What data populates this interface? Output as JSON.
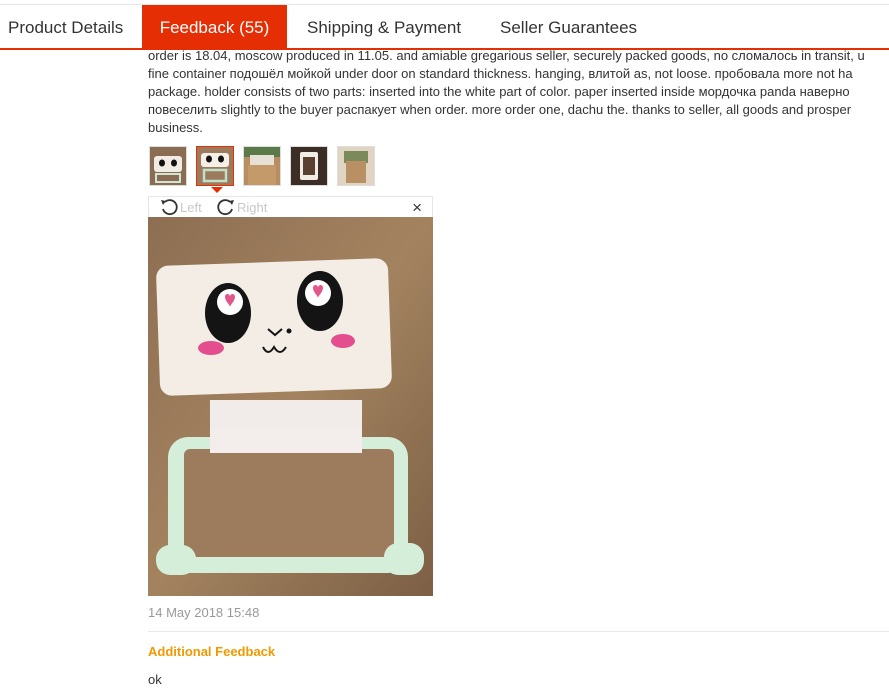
{
  "tabs": {
    "product_details": "Product Details",
    "feedback": "Feedback (55)",
    "shipping": "Shipping & Payment",
    "guarantees": "Seller Guarantees"
  },
  "review": {
    "lines": [
      "order is 18.04, moscow produced in 11.05. and amiable gregarious seller, securely packed goods, no сломалось in transit, u",
      "fine container подошёл мойкой under door on standard thickness. hanging, влитой as, not loose. пробовала more not ha",
      "package. holder consists of two parts: inserted into the white part of color. paper inserted inside мордочка panda наверно",
      "повеселить slightly to the buyer распакует when order. more order one, dachu the. thanks to seller, all goods and prosper",
      "business."
    ],
    "date": "14 May 2018 15:48"
  },
  "viewer": {
    "left_label": "Left",
    "right_label": "Right",
    "close_glyph": "×"
  },
  "additional": {
    "title": "Additional Feedback",
    "text": "ok"
  },
  "colors": {
    "accent": "#e62e04",
    "additional_title": "#f39800",
    "muted": "#999999"
  }
}
